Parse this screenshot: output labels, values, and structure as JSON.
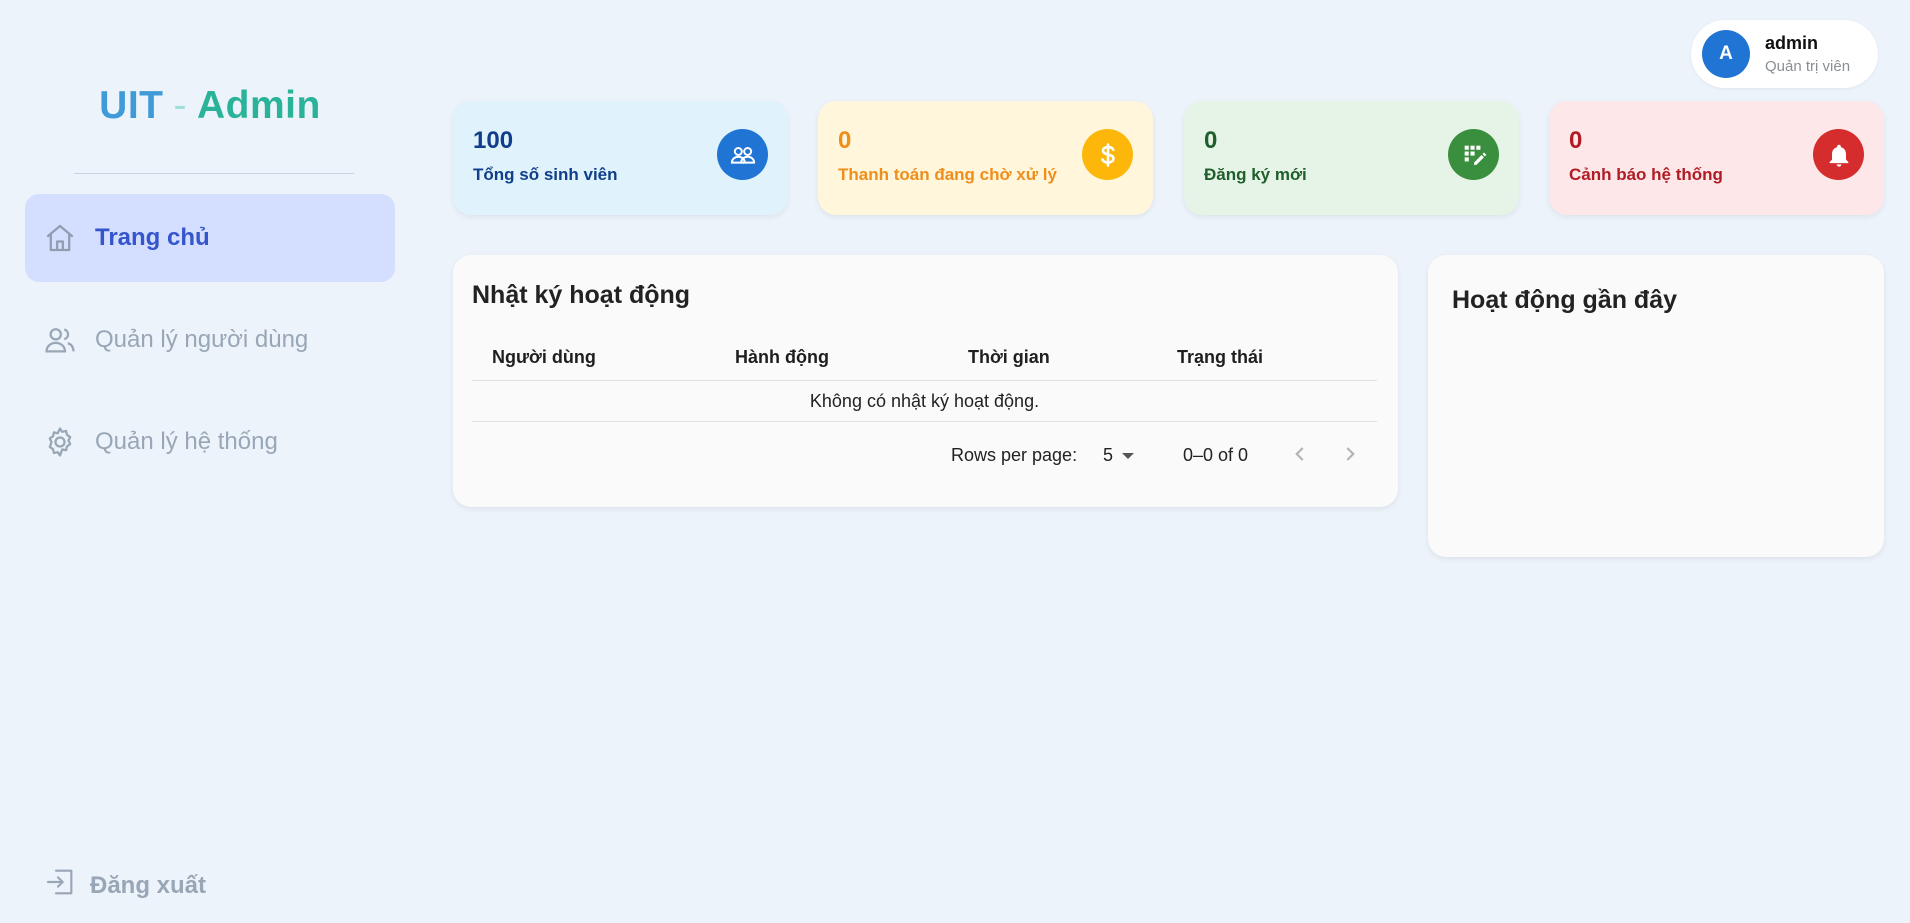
{
  "brand": {
    "part1": "UIT",
    "separator": "-",
    "part2": "Admin"
  },
  "sidebar": {
    "items": [
      {
        "label": "Trang chủ",
        "icon": "home-icon",
        "active": true
      },
      {
        "label": "Quản lý người dùng",
        "icon": "users-icon",
        "active": false
      },
      {
        "label": "Quản lý hệ thống",
        "icon": "gear-icon",
        "active": false
      }
    ],
    "logout": {
      "label": "Đăng xuất",
      "icon": "logout-icon"
    }
  },
  "profile": {
    "avatar_letter": "A",
    "name": "admin",
    "role": "Quản trị viên"
  },
  "stats": [
    {
      "value": "100",
      "label": "Tổng số sinh viên",
      "icon": "students-icon",
      "bg": "#e0f3fc",
      "fg": "#103e8a",
      "icon_bg": "#1f74d4"
    },
    {
      "value": "0",
      "label": "Thanh toán đang chờ xử lý",
      "icon": "dollar-icon",
      "bg": "#fff6db",
      "fg": "#f08e1b",
      "icon_bg": "#fcb70a"
    },
    {
      "value": "0",
      "label": "Đăng ký mới",
      "icon": "registration-icon",
      "bg": "#e6f4e7",
      "fg": "#1e5f2c",
      "icon_bg": "#3a8f3f"
    },
    {
      "value": "0",
      "label": "Cảnh báo hệ thống",
      "icon": "bell-icon",
      "bg": "#fde7e9",
      "fg": "#b01c25",
      "icon_bg": "#d52d2d"
    }
  ],
  "activity_log": {
    "title": "Nhật ký hoạt động",
    "columns": [
      "Người dùng",
      "Hành động",
      "Thời gian",
      "Trạng thái"
    ],
    "empty_text": "Không có nhật ký hoạt động.",
    "pagination": {
      "rows_label": "Rows per page:",
      "rows_value": "5",
      "range": "0–0 of 0"
    }
  },
  "recent_activity": {
    "title": "Hoạt động gần đây"
  }
}
